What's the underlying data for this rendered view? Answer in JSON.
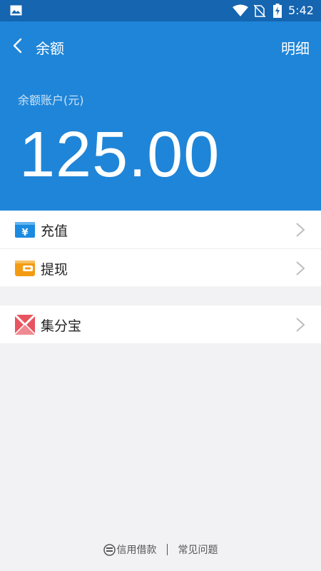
{
  "status_bar": {
    "time": "5:42"
  },
  "header": {
    "title": "余额",
    "detail_button": "明细",
    "account_label": "余额账户(元)",
    "balance": "125.00",
    "color": "#1f85d8"
  },
  "menu_group1": [
    {
      "label": "充值",
      "icon": "recharge-icon"
    },
    {
      "label": "提现",
      "icon": "withdraw-icon"
    }
  ],
  "menu_group2": [
    {
      "label": "集分宝",
      "icon": "jifenbao-icon"
    }
  ],
  "footer": {
    "credit_loan": "信用借款",
    "faq": "常见问题"
  }
}
